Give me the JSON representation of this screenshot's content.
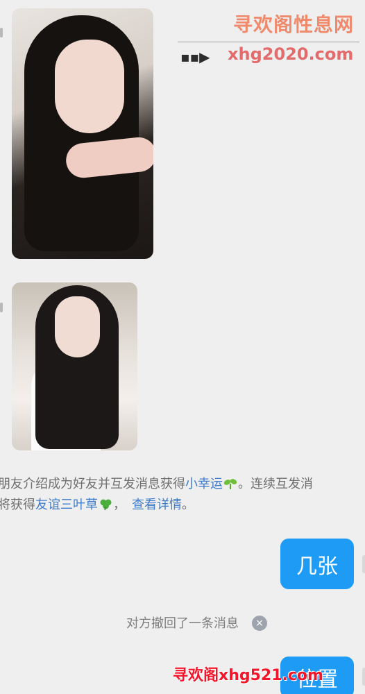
{
  "watermark_top": {
    "title": "寻欢阁性息网",
    "url": "xhg2020.com",
    "arrow": "▪▪▶"
  },
  "notice": {
    "line1_a": "朋友介绍成为好友并互发消息获得",
    "link_lucky": "小幸运",
    "line1_b": "。连续互发消",
    "line2_a": "将获得",
    "link_clover": "友谊三叶草",
    "line2_b": "，",
    "link_details": "查看详情",
    "line2_c": "。"
  },
  "messages": {
    "bubble1": "几张",
    "recall_text": "对方撤回了一条消息",
    "recall_icon": "×",
    "bubble2": "位置"
  },
  "watermark_bottom": "寻欢阁xhg521.com",
  "colors": {
    "background": "#efefef",
    "bubble": "#1e9cf5",
    "link": "#3e7ccc",
    "notice_text": "#6f6f6f"
  },
  "icons": {
    "lucky": "sprout-icon",
    "clover": "clover-icon",
    "recall_close": "close-icon"
  }
}
